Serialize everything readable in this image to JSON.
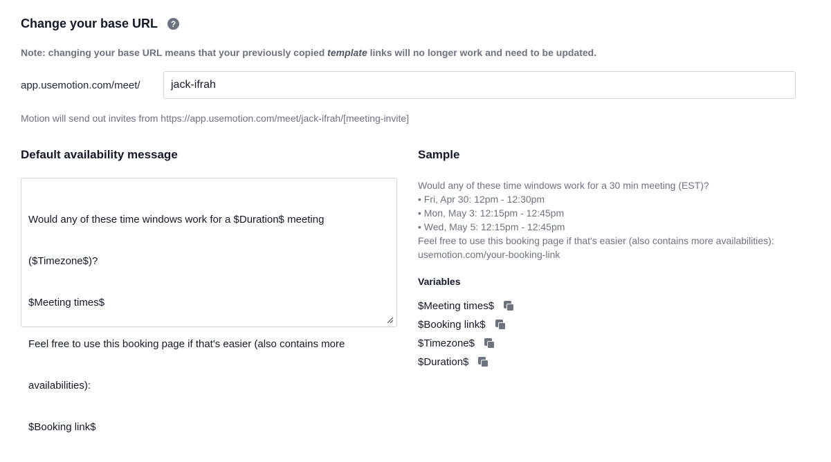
{
  "base_url": {
    "title": "Change your base URL",
    "help_icon_glyph": "?",
    "note_prefix": "Note: changing your base URL means that your previously copied ",
    "note_emphasis": "template",
    "note_suffix": " links will no longer work and need to be updated.",
    "prefix": "app.usemotion.com/meet/",
    "slug_value": "jack-ifrah",
    "invite_text": "Motion will send out invites from https://app.usemotion.com/meet/jack-ifrah/[meeting-invite]"
  },
  "availability": {
    "title": "Default availability message",
    "lines": [
      "Would any of these time windows work for a $Duration$ meeting",
      "($Timezone$)?",
      "$Meeting times$",
      "Feel free to use this booking page if that's easier (also contains more",
      "availabilities):",
      "$Booking link$"
    ]
  },
  "sample": {
    "title": "Sample",
    "lines": [
      "Would any of these time windows work for a 30 min meeting (EST)?",
      "• Fri, Apr 30: 12pm - 12:30pm",
      "• Mon, May 3: 12:15pm - 12:45pm",
      "• Wed, May 5: 12:15pm - 12:45pm",
      "Feel free to use this booking page if that's easier (also contains more availabilities):",
      "usemotion.com/your-booking-link"
    ]
  },
  "variables": {
    "title": "Variables",
    "items": [
      "$Meeting times$",
      "$Booking link$",
      "$Timezone$",
      "$Duration$"
    ],
    "copy_icon": "copy-icon"
  }
}
